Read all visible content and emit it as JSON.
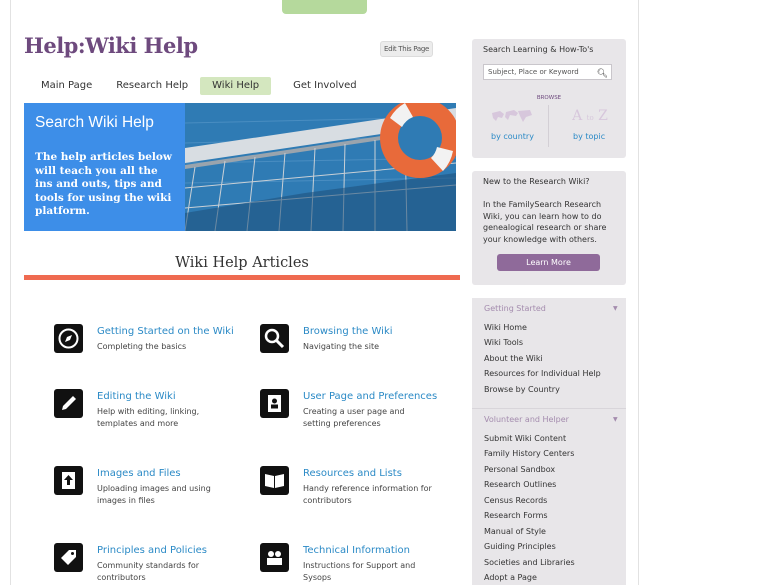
{
  "page": {
    "title": "Help:Wiki Help",
    "edit_label": "Edit This Page"
  },
  "nav": {
    "tabs": [
      {
        "label": "Main Page",
        "active": false
      },
      {
        "label": "Research Help",
        "active": false
      },
      {
        "label": "Wiki Help",
        "active": true
      },
      {
        "label": "Get Involved",
        "active": false
      }
    ]
  },
  "hero": {
    "title": "Search Wiki Help",
    "text": "The help articles below will teach you all the ins and outs, tips and tools for using the wiki platform."
  },
  "section": {
    "title": "Wiki Help Articles"
  },
  "articles": [
    {
      "title": "Getting Started on the Wiki",
      "desc": "Completing the basics",
      "icon": "compass-icon"
    },
    {
      "title": "Browsing the Wiki",
      "desc": "Navigating the site",
      "icon": "magnifier-icon"
    },
    {
      "title": "Editing the Wiki",
      "desc": "Help with editing, linking, templates and more",
      "icon": "pencil-icon"
    },
    {
      "title": "User Page and Preferences",
      "desc": "Creating a user page and setting preferences",
      "icon": "user-page-icon"
    },
    {
      "title": "Images and Files",
      "desc": "Uploading images and using images in files",
      "icon": "file-upload-icon"
    },
    {
      "title": "Resources and Lists",
      "desc": "Handy reference information for contributors",
      "icon": "book-icon"
    },
    {
      "title": "Principles and Policies",
      "desc": "Community standards for contributors",
      "icon": "tag-icon"
    },
    {
      "title": "Technical Information",
      "desc": "Instructions for Support and Sysops",
      "icon": "people-icon"
    }
  ],
  "search": {
    "label": "Search Learning & How-To's",
    "placeholder": "Subject, Place or Keyword",
    "browse_label": "BROWSE",
    "by_country": "by country",
    "by_topic": "by topic",
    "az_a": "A",
    "az_to": "to",
    "az_z": "Z"
  },
  "new_box": {
    "heading": "New to the Research Wiki?",
    "text": "In the FamilySearch Research Wiki, you can learn how to do genealogical research or share your knowledge with others.",
    "button": "Learn More"
  },
  "menu": {
    "getting_started": {
      "heading": "Getting Started",
      "items": [
        "Wiki Home",
        "Wiki Tools",
        "About the Wiki",
        "Resources for Individual Help",
        "Browse by Country"
      ]
    },
    "volunteer": {
      "heading": "Volunteer and Helper",
      "items": [
        "Submit Wiki Content",
        "Family History Centers",
        "Personal Sandbox",
        "Research Outlines",
        "Census Records",
        "Research Forms",
        "Manual of Style",
        "Guiding Principles",
        "Societies and Libraries",
        "Adopt a Page"
      ]
    }
  },
  "colors": {
    "title_purple": "#6e4a7e",
    "nav_active": "#d4e7bf",
    "hero_blue": "#3d8ee8",
    "rule_red": "#ef6a50",
    "link_blue": "#2b8ac6",
    "button_purple": "#8f6a9a"
  }
}
